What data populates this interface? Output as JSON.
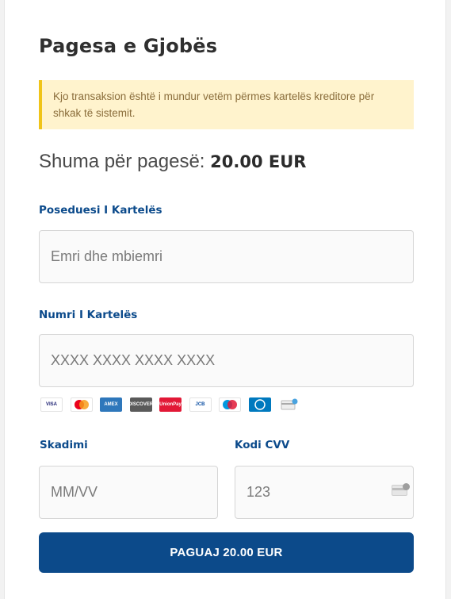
{
  "form": {
    "title": "Pagesa e Gjobës",
    "notice": "Kjo transaksion është i mundur vetëm përmes kartelës kreditore për shkak të sistemit.",
    "amount_label": "Shuma për pagesë:",
    "amount_value": "20.00 EUR",
    "cardholder": {
      "label": "Poseduesi I Kartelës",
      "placeholder": "Emri dhe mbiemri",
      "value": ""
    },
    "card_number": {
      "label": "Numri I Kartelës",
      "placeholder": "XXXX XXXX XXXX XXXX",
      "value": ""
    },
    "expiry": {
      "label": "Skadimi",
      "placeholder": "MM/VV",
      "value": ""
    },
    "cvv": {
      "label": "Kodi CVV",
      "placeholder": "123",
      "value": ""
    },
    "pay_button": "PAGUAJ 20.00 EUR"
  },
  "card_brands": [
    {
      "name": "visa-icon",
      "text": "VISA",
      "bg": "#ffffff",
      "fg": "#1a1f71"
    },
    {
      "name": "mastercard-icon",
      "text": "",
      "bg": "#ffffff",
      "fg": "#eb001b"
    },
    {
      "name": "american-express-icon",
      "text": "AMEX",
      "bg": "#2e77bb",
      "fg": "#ffffff"
    },
    {
      "name": "discover-icon",
      "text": "DISCOVER",
      "bg": "#5a5a5a",
      "fg": "#ffffff"
    },
    {
      "name": "unionpay-icon",
      "text": "UnionPay",
      "bg": "#e21836",
      "fg": "#ffffff"
    },
    {
      "name": "jcb-icon",
      "text": "JCB",
      "bg": "#ffffff",
      "fg": "#0b4ea2"
    },
    {
      "name": "maestro-icon",
      "text": "",
      "bg": "#ffffff",
      "fg": "#0099df"
    },
    {
      "name": "diners-club-icon",
      "text": "",
      "bg": "#0079be",
      "fg": "#ffffff"
    },
    {
      "name": "generic-card-icon",
      "text": "",
      "bg": "#ffffff",
      "fg": "#9e9e9e"
    }
  ],
  "colors": {
    "accent": "#0c4a8a",
    "notice_bg": "#fff3cd",
    "notice_border": "#f0c419",
    "notice_text": "#8a6d3b"
  }
}
